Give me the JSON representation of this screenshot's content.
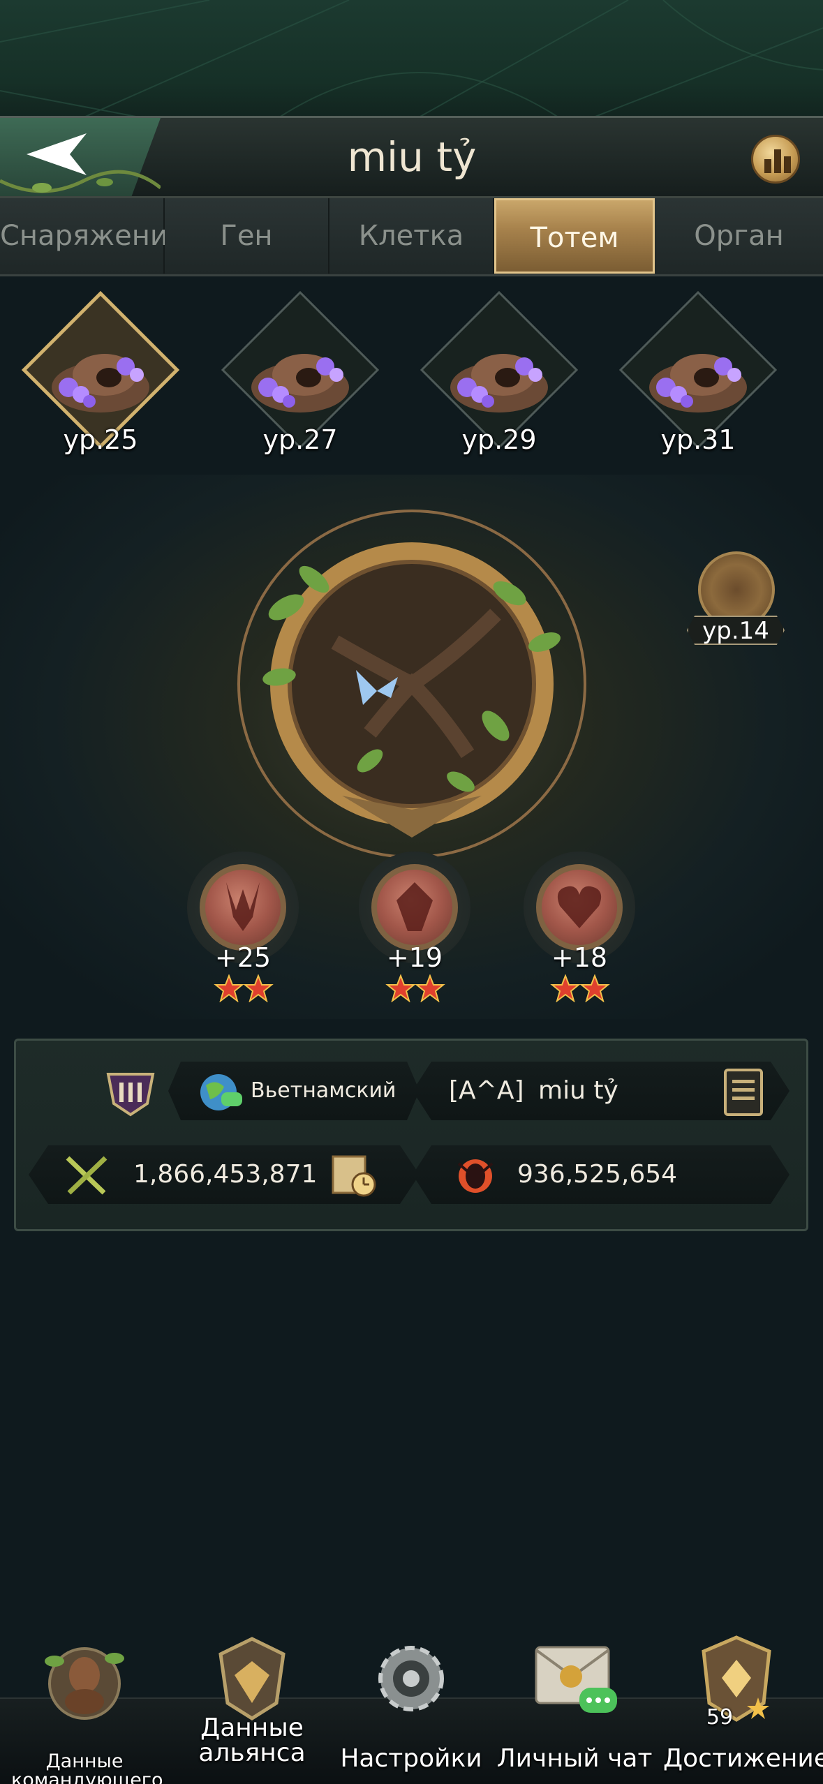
{
  "header": {
    "title": "miu tỷ"
  },
  "tabs": [
    {
      "label": "Снаряжение",
      "active": false
    },
    {
      "label": "Ген",
      "active": false
    },
    {
      "label": "Клетка",
      "active": false
    },
    {
      "label": "Тотем",
      "active": true
    },
    {
      "label": "Орган",
      "active": false
    }
  ],
  "totems": [
    {
      "level": "ур.25",
      "selected": true
    },
    {
      "level": "ур.27",
      "selected": false
    },
    {
      "level": "ур.29",
      "selected": false
    },
    {
      "level": "ур.31",
      "selected": false
    }
  ],
  "side_badge": {
    "level": "ур.14"
  },
  "attributes": [
    {
      "value": "+25",
      "icon": "claw-icon",
      "stars": 2
    },
    {
      "value": "+19",
      "icon": "gem-icon",
      "stars": 2
    },
    {
      "value": "+18",
      "icon": "heart-icon",
      "stars": 2
    }
  ],
  "info": {
    "language": "Вьетнамский",
    "alliance_tag": "[A^A]",
    "player_name": "miu tỷ",
    "power": "1,866,453,871",
    "kills": "936,525,654"
  },
  "nav": [
    {
      "label": "Данные командующего",
      "icon": "commander-icon"
    },
    {
      "label": "Данные альянса",
      "icon": "alliance-icon"
    },
    {
      "label": "Настройки",
      "icon": "gear-icon"
    },
    {
      "label": "Личный чат",
      "icon": "mail-chat-icon"
    },
    {
      "label": "Достижение",
      "icon": "achievement-icon",
      "badge": "59"
    }
  ],
  "colors": {
    "accent_gold": "#c9a66a",
    "background": "#0f1a1e",
    "panel": "#1e2b28"
  }
}
